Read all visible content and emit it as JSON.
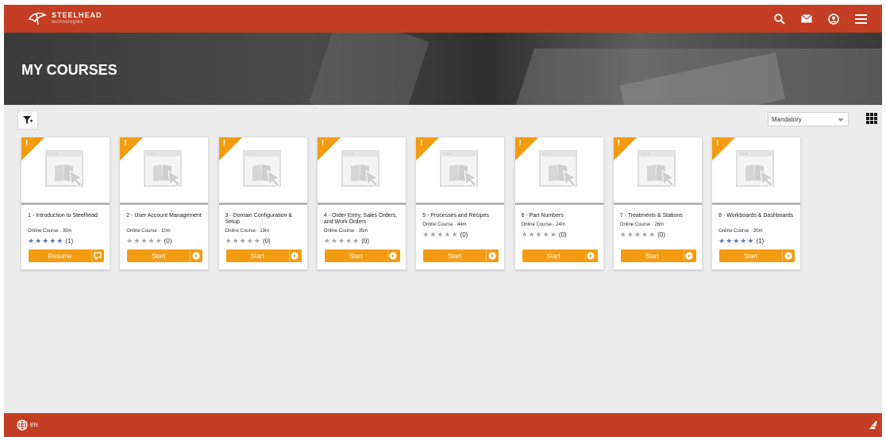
{
  "header": {
    "brand_name": "STEELHEAD",
    "brand_sub": "technologies",
    "icons": [
      "search-icon",
      "mail-icon",
      "user-circle-icon",
      "menu-icon"
    ]
  },
  "hero": {
    "title": "MY COURSES"
  },
  "toolbar": {
    "filter_icon": "filter-icon",
    "select_value": "Mandatory",
    "grid_icon": "grid-view-icon"
  },
  "theme": {
    "accent": "#c43d25",
    "button": "#f39c12",
    "star_filled": "#5b7bb0",
    "star_empty": "#a8a8a8"
  },
  "courses": [
    {
      "title": "1 - Introduction to Steelhead",
      "meta": "Online Course · 35m",
      "rating_count": "(1)",
      "rated": true,
      "button": "Resume",
      "button_icon": "chat-icon"
    },
    {
      "title": "2 - User Account Management",
      "meta": "Online Course · 10m",
      "rating_count": "(0)",
      "rated": false,
      "button": "Start",
      "button_icon": "play-icon"
    },
    {
      "title": "3 - Domain Configuration & Setup",
      "meta": "Online Course · 19m",
      "rating_count": "(0)",
      "rated": false,
      "button": "Start",
      "button_icon": "play-icon"
    },
    {
      "title": "4 - Order Entry, Sales Orders, and Work Orders",
      "meta": "Online Course · 35m",
      "rating_count": "(0)",
      "rated": false,
      "button": "Start",
      "button_icon": "play-icon"
    },
    {
      "title": "5 - Processes and Recipes",
      "meta": "Online Course · 44m",
      "rating_count": "(0)",
      "rated": false,
      "button": "Start",
      "button_icon": "play-icon"
    },
    {
      "title": "6 - Part Numbers",
      "meta": "Online Course · 24m",
      "rating_count": "(0)",
      "rated": false,
      "button": "Start",
      "button_icon": "play-icon"
    },
    {
      "title": "7 - Treatments & Stations",
      "meta": "Online Course · 26m",
      "rating_count": "(0)",
      "rated": false,
      "button": "Start",
      "button_icon": "play-icon"
    },
    {
      "title": "8 - Workboards & Dashboards",
      "meta": "Online Course · 20m",
      "rating_count": "(1)",
      "rated": true,
      "button": "Start",
      "button_icon": "play-icon"
    }
  ],
  "footer": {
    "language": "EN",
    "globe_icon": "globe-icon",
    "brand_icon": "brand-logo-icon"
  }
}
